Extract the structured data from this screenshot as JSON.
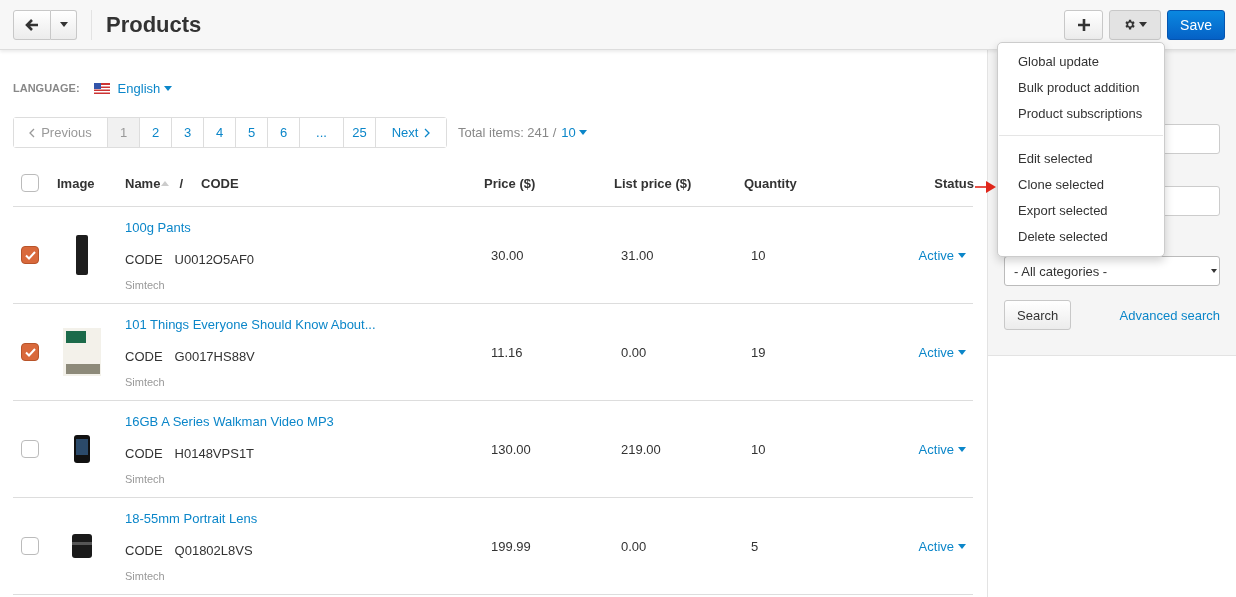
{
  "header": {
    "title": "Products",
    "save": "Save"
  },
  "settings_menu": {
    "open": true,
    "groups": [
      [
        "Global update",
        "Bulk product addition",
        "Product subscriptions"
      ],
      [
        "Edit selected",
        "Clone selected",
        "Export selected",
        "Delete selected"
      ]
    ]
  },
  "language": {
    "label": "LANGUAGE:",
    "value": "English"
  },
  "pagination": {
    "previous": "Previous",
    "previous_disabled": true,
    "pages": [
      {
        "label": "1",
        "selected": true
      },
      {
        "label": "2",
        "selected": false
      },
      {
        "label": "3",
        "selected": false
      },
      {
        "label": "4",
        "selected": false
      },
      {
        "label": "5",
        "selected": false
      },
      {
        "label": "6",
        "selected": false
      },
      {
        "label": "...",
        "selected": false
      },
      {
        "label": "25",
        "selected": false
      }
    ],
    "next": "Next",
    "total": "Total items: 241 /",
    "per_page": "10"
  },
  "table": {
    "select_all_checked": false,
    "columns": {
      "image": "Image",
      "name": "Name",
      "separator": "/",
      "code": "CODE",
      "price": "Price ($)",
      "list_price": "List price ($)",
      "quantity": "Quantity",
      "status": "Status"
    },
    "rows": [
      {
        "checked": true,
        "kind": "pants",
        "name": "100g Pants",
        "code_label": "CODE",
        "code": "U0012O5AF0",
        "vendor": "Simtech",
        "price": "30.00",
        "list_price": "31.00",
        "quantity": "10",
        "status": "Active"
      },
      {
        "checked": true,
        "kind": "book",
        "name": "101 Things Everyone Should Know About...",
        "code_label": "CODE",
        "code": "G0017HS88V",
        "vendor": "Simtech",
        "price": "11.16",
        "list_price": "0.00",
        "quantity": "19",
        "status": "Active"
      },
      {
        "checked": false,
        "kind": "player",
        "name": "16GB A Series Walkman Video MP3",
        "code_label": "CODE",
        "code": "H0148VPS1T",
        "vendor": "Simtech",
        "price": "130.00",
        "list_price": "219.00",
        "quantity": "10",
        "status": "Active"
      },
      {
        "checked": false,
        "kind": "lens",
        "name": "18-55mm Portrait Lens",
        "code_label": "CODE",
        "code": "Q01802L8VS",
        "vendor": "Simtech",
        "price": "199.99",
        "list_price": "0.00",
        "quantity": "5",
        "status": "Active"
      }
    ]
  },
  "sidebar": {
    "category": "- All categories -",
    "search_button": "Search",
    "advanced_search": "Advanced search"
  }
}
